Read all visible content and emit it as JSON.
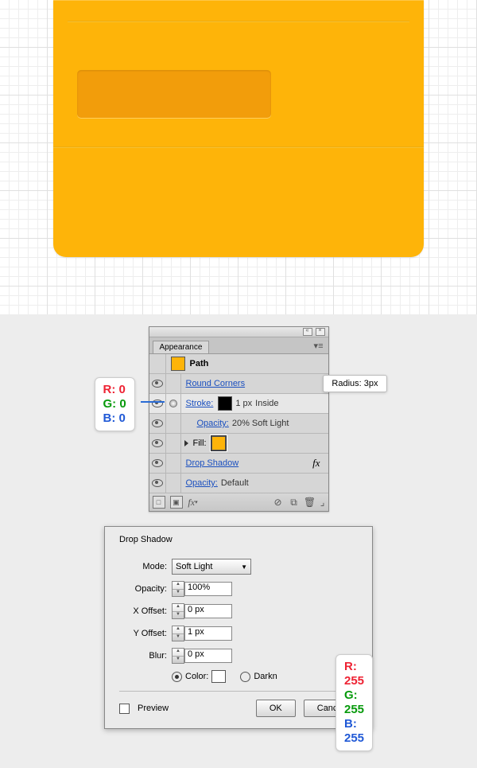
{
  "envelope": {
    "main_color": "#feb409",
    "window_color": "#f29d0b"
  },
  "rgb_stroke": {
    "r_label": "R: 0",
    "g_label": "G: 0",
    "b_label": "B: 0"
  },
  "appearance": {
    "tab": "Appearance",
    "menu_glyph": "▾≡",
    "path_label": "Path",
    "round_corners": "Round Corners",
    "radius_callout": "Radius: 3px",
    "stroke_label": "Stroke:",
    "stroke_width": "1 px",
    "stroke_align": "Inside",
    "stroke_opacity_label": "Opacity:",
    "stroke_opacity_value": "20% Soft Light",
    "fill_label": "Fill:",
    "drop_shadow": "Drop Shadow",
    "fx": "fx",
    "fill_opacity_label": "Opacity:",
    "fill_opacity_value": "Default"
  },
  "dropshadow": {
    "title": "Drop Shadow",
    "mode_label": "Mode:",
    "mode_value": "Soft Light",
    "opacity_label": "Opacity:",
    "opacity_value": "100%",
    "xoffset_label": "X Offset:",
    "xoffset_value": "0 px",
    "yoffset_label": "Y Offset:",
    "yoffset_value": "1 px",
    "blur_label": "Blur:",
    "blur_value": "0 px",
    "color_label": "Color:",
    "darkness_label": "Darkn",
    "preview": "Preview",
    "ok": "OK",
    "cancel": "Cancel"
  },
  "rgb_shadow": {
    "r_label": "R: 255",
    "g_label": "G: 255",
    "b_label": "B: 255"
  }
}
